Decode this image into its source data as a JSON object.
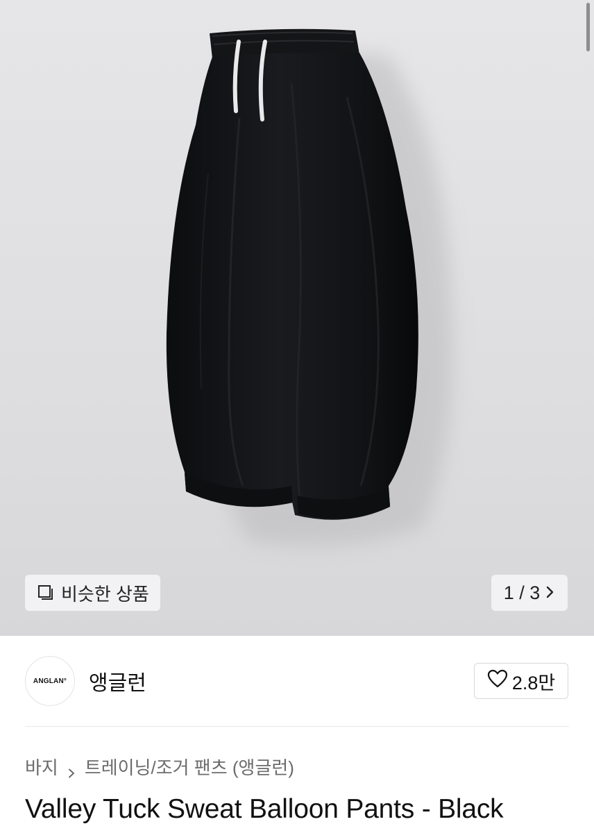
{
  "gallery": {
    "similar_label": "비슷한 상품",
    "similar_icon": "similar-products-icon",
    "page_indicator": "1 / 3",
    "next_icon": "chevron-right-icon"
  },
  "brand": {
    "logo_text": "ANGLAN°",
    "name": "앵글런"
  },
  "like": {
    "icon": "heart-icon",
    "count": "2.8만"
  },
  "breadcrumb": {
    "items": [
      "바지",
      "트레이닝/조거 팬츠 (앵글런)"
    ]
  },
  "product": {
    "title": "Valley Tuck Sweat Balloon Pants - Black"
  }
}
